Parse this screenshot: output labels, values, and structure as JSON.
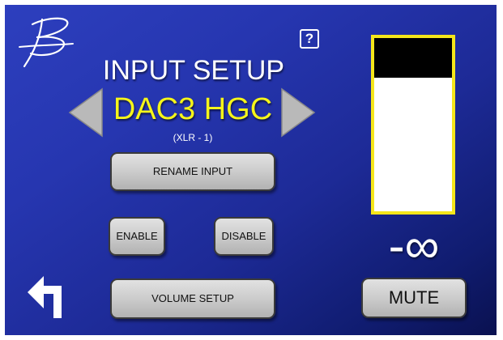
{
  "header": {
    "title": "INPUT SETUP",
    "help_icon": "question-mark-icon",
    "help_glyph": "?"
  },
  "input": {
    "name": "DAC3 HGC",
    "connection": "(XLR - 1)",
    "prev_icon": "left-triangle-icon",
    "next_icon": "right-triangle-icon"
  },
  "buttons": {
    "rename": "RENAME INPUT",
    "enable": "ENABLE",
    "disable": "DISABLE",
    "volume_setup": "VOLUME SETUP",
    "mute": "MUTE"
  },
  "meter": {
    "level_text": "-∞",
    "peak_fraction": 0.23
  },
  "colors": {
    "accent_yellow": "#f5f51a",
    "meter_border": "#f5e61a",
    "background_blue": "#2636b0",
    "button_gray": "#c9c9c9"
  },
  "icons": {
    "logo": "signature-logo-icon",
    "back": "back-arrow-icon"
  }
}
